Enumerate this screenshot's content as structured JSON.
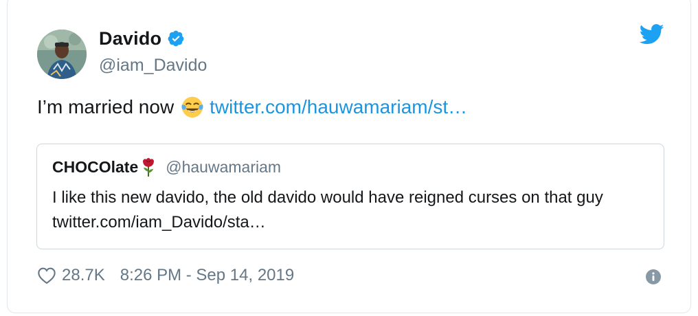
{
  "tweet": {
    "author": {
      "display_name": "Davido",
      "handle": "@iam_Davido",
      "verified": true
    },
    "text": "I’m married now",
    "emoji": "face-with-tears-of-joy",
    "link_text": "twitter.com/hauwamariam/st…",
    "quoted": {
      "display_name": "CHOCOlate",
      "emoji": "rose",
      "handle": "@hauwamariam",
      "body": "I like this new davido, the old davido would have reigned curses on that guy twitter.com/iam_Davido/sta…"
    },
    "footer": {
      "like_count": "28.7K",
      "timestamp": "8:26 PM - Sep 14, 2019"
    }
  },
  "icons": {
    "brand": "twitter-bird-icon",
    "verified": "verified-badge-icon",
    "like": "heart-icon",
    "info": "info-icon"
  },
  "colors": {
    "twitter_blue": "#1da1f2",
    "link_blue": "#1b95e0",
    "secondary_text": "#657786",
    "border": "#ccd6dd"
  }
}
